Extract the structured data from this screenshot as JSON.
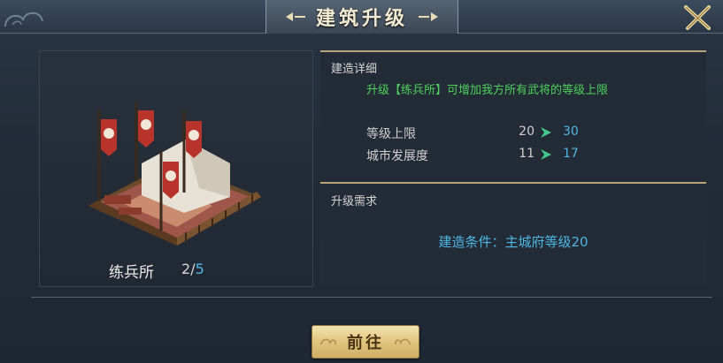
{
  "dialog": {
    "title": "建筑升级"
  },
  "building": {
    "name": "练兵所",
    "count_current": "2",
    "count_separator": "/",
    "count_max": "5"
  },
  "details": {
    "section_title": "建造详细",
    "description": "升级【练兵所】可增加我方所有武将的等级上限",
    "stats": [
      {
        "label": "等级上限",
        "from": "20",
        "to": "30"
      },
      {
        "label": "城市发展度",
        "from": "11",
        "to": "17"
      }
    ]
  },
  "requirements": {
    "section_title": "升级需求",
    "condition": "建造条件：主城府等级20"
  },
  "actions": {
    "go_label": "前往"
  },
  "colors": {
    "accent_gold": "#b9a377",
    "value_blue": "#4fb7e6",
    "desc_green": "#4ed15a",
    "arrow_green": "#43c98a"
  },
  "icons": {
    "close": "crossed-swords-close-icon",
    "arrow": "right-arrow-icon"
  }
}
